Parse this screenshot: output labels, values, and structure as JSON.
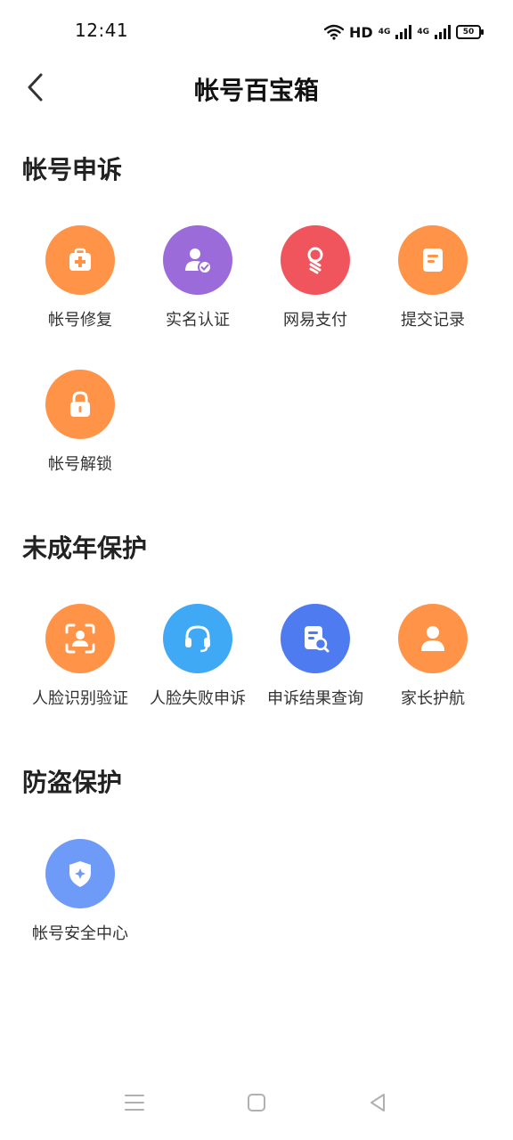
{
  "status_bar": {
    "time": "12:41",
    "hd": "HD",
    "net1": "4G",
    "net2": "4G",
    "battery": "50"
  },
  "header": {
    "title": "帐号百宝箱"
  },
  "sections": [
    {
      "title": "帐号申诉",
      "items": [
        {
          "label": "帐号修复",
          "color": "#FF9347",
          "icon": "medical-kit-icon"
        },
        {
          "label": "实名认证",
          "color": "#9B6BD9",
          "icon": "verified-user-icon"
        },
        {
          "label": "网易支付",
          "color": "#F0545D",
          "icon": "payment-ribbon-icon"
        },
        {
          "label": "提交记录",
          "color": "#FF9347",
          "icon": "document-list-icon"
        },
        {
          "label": "帐号解锁",
          "color": "#FF9347",
          "icon": "lock-icon"
        }
      ]
    },
    {
      "title": "未成年保护",
      "items": [
        {
          "label": "人脸识别验证",
          "color": "#FF9347",
          "icon": "face-scan-icon"
        },
        {
          "label": "人脸失败申诉",
          "color": "#3FA9F5",
          "icon": "headset-icon"
        },
        {
          "label": "申诉结果查询",
          "color": "#4E7BEF",
          "icon": "document-search-icon"
        },
        {
          "label": "家长护航",
          "color": "#FF9347",
          "icon": "parent-user-icon"
        }
      ]
    },
    {
      "title": "防盗保护",
      "items": [
        {
          "label": "帐号安全中心",
          "color": "#6E9BF7",
          "icon": "shield-icon"
        }
      ]
    }
  ],
  "nav_bar": {
    "menu_icon": "menu-icon",
    "home_icon": "home-square-icon",
    "back_icon": "back-triangle-icon"
  }
}
